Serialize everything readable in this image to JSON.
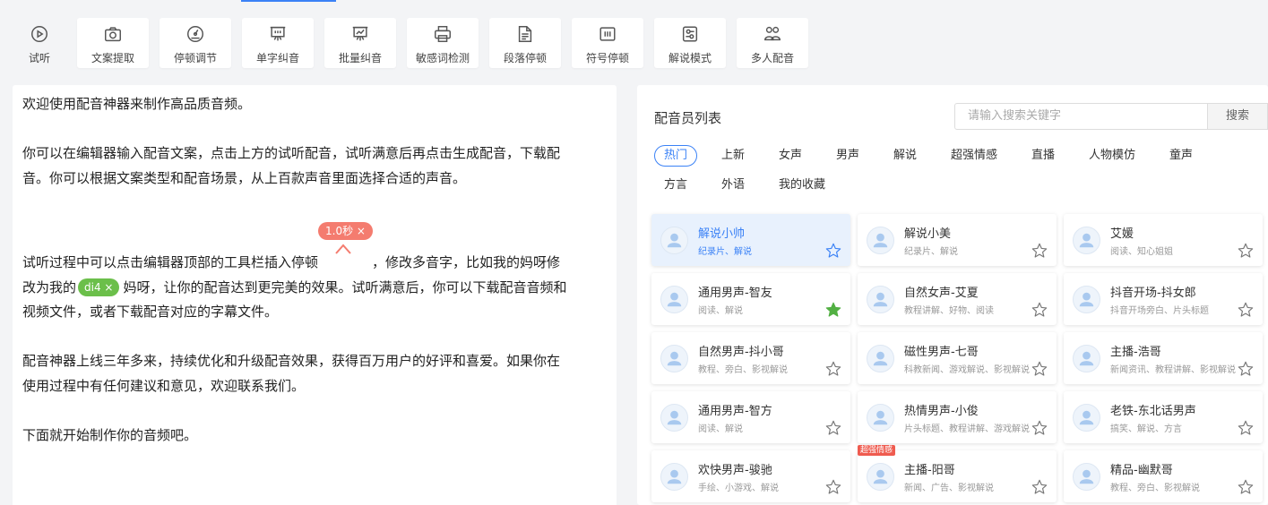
{
  "toolbar": {
    "items": [
      {
        "label": "试听",
        "icon": "play-icon"
      },
      {
        "label": "文案提取",
        "icon": "camera-icon"
      },
      {
        "label": "停顿调节",
        "icon": "gauge-icon"
      },
      {
        "label": "单字纠音",
        "icon": "board-icon"
      },
      {
        "label": "批量纠音",
        "icon": "chart-board-icon"
      },
      {
        "label": "敏感词检测",
        "icon": "printer-icon"
      },
      {
        "label": "段落停顿",
        "icon": "document-icon"
      },
      {
        "label": "符号停顿",
        "icon": "pause-symbol-icon"
      },
      {
        "label": "解说模式",
        "icon": "settings-icon"
      },
      {
        "label": "多人配音",
        "icon": "users-icon"
      }
    ]
  },
  "editor": {
    "p1": "欢迎使用配音神器来制作高品质音频。",
    "p2a": "你可以在编辑器输入配音文案，点击上方的试听配音，试听满意后再点击生成配音，下载配",
    "p2b": "音。你可以根据文案类型和配音场景，从上百款声音里面选择合适的声音。",
    "p3a": "试听过程中可以点击编辑器顶部的工具栏插入停顿",
    "pause_tag": "1.0秒 ×",
    "p3b": "，修改多音字，比如我的妈呀修",
    "p3c": "改为我的",
    "pron_tag": "di4 ×",
    "p3d": "妈呀，让你的配音达到更完美的效果。试听满意后，你可以下载配音音频和",
    "p3e": "视频文件，或者下载配音对应的字幕文件。",
    "p4a": "配音神器上线三年多来，持续优化和升级配音效果，获得百万用户的好评和喜爱。如果你在",
    "p4b": "使用过程中有任何建议和意见，欢迎联系我们。",
    "p5": "下面就开始制作你的音频吧。"
  },
  "panel": {
    "title": "配音员列表",
    "search_placeholder": "请输入搜索关键字",
    "search_button": "搜索",
    "categories": [
      "热门",
      "上新",
      "女声",
      "男声",
      "解说",
      "超强情感",
      "直播",
      "人物模仿",
      "童声",
      "方言",
      "外语",
      "我的收藏"
    ],
    "active_category": "热门",
    "voices": [
      {
        "name": "解说小帅",
        "tags": "纪录片、解说",
        "favorite": false,
        "selected": true,
        "badge": ""
      },
      {
        "name": "解说小美",
        "tags": "纪录片、解说",
        "favorite": false,
        "selected": false,
        "badge": ""
      },
      {
        "name": "艾媛",
        "tags": "阅读、知心姐姐",
        "favorite": false,
        "selected": false,
        "badge": ""
      },
      {
        "name": "通用男声-智友",
        "tags": "阅读、解说",
        "favorite": true,
        "selected": false,
        "badge": ""
      },
      {
        "name": "自然女声-艾夏",
        "tags": "教程讲解、好物、阅读",
        "favorite": false,
        "selected": false,
        "badge": ""
      },
      {
        "name": "抖音开场-抖女郎",
        "tags": "抖音开场旁白、片头标题",
        "favorite": false,
        "selected": false,
        "badge": ""
      },
      {
        "name": "自然男声-抖小哥",
        "tags": "教程、旁白、影视解说",
        "favorite": false,
        "selected": false,
        "badge": ""
      },
      {
        "name": "磁性男声-七哥",
        "tags": "科教新闻、游戏解说、影视解说",
        "favorite": false,
        "selected": false,
        "badge": ""
      },
      {
        "name": "主播-浩哥",
        "tags": "新闻资讯、教程讲解、影视解说",
        "favorite": false,
        "selected": false,
        "badge": ""
      },
      {
        "name": "通用男声-智方",
        "tags": "阅读、解说",
        "favorite": false,
        "selected": false,
        "badge": ""
      },
      {
        "name": "热情男声-小俊",
        "tags": "片头标题、教程讲解、游戏解说",
        "favorite": false,
        "selected": false,
        "badge": ""
      },
      {
        "name": "老铁-东北话男声",
        "tags": "搞笑、解说、方言",
        "favorite": false,
        "selected": false,
        "badge": ""
      },
      {
        "name": "欢快男声-骏驰",
        "tags": "手绘、小游戏、解说",
        "favorite": false,
        "selected": false,
        "badge": ""
      },
      {
        "name": "主播-阳哥",
        "tags": "新闻、广告、影视解说",
        "favorite": false,
        "selected": false,
        "badge": "超强情感"
      },
      {
        "name": "精品-幽默哥",
        "tags": "教程、旁白、影视解说",
        "favorite": false,
        "selected": false,
        "badge": ""
      }
    ]
  },
  "colors": {
    "accent": "#3b82f6",
    "pause_tag": "#f47c6f",
    "pron_tag": "#6bbf4a",
    "favorite_star": "#52b043",
    "badge": "#ef5b4f"
  }
}
